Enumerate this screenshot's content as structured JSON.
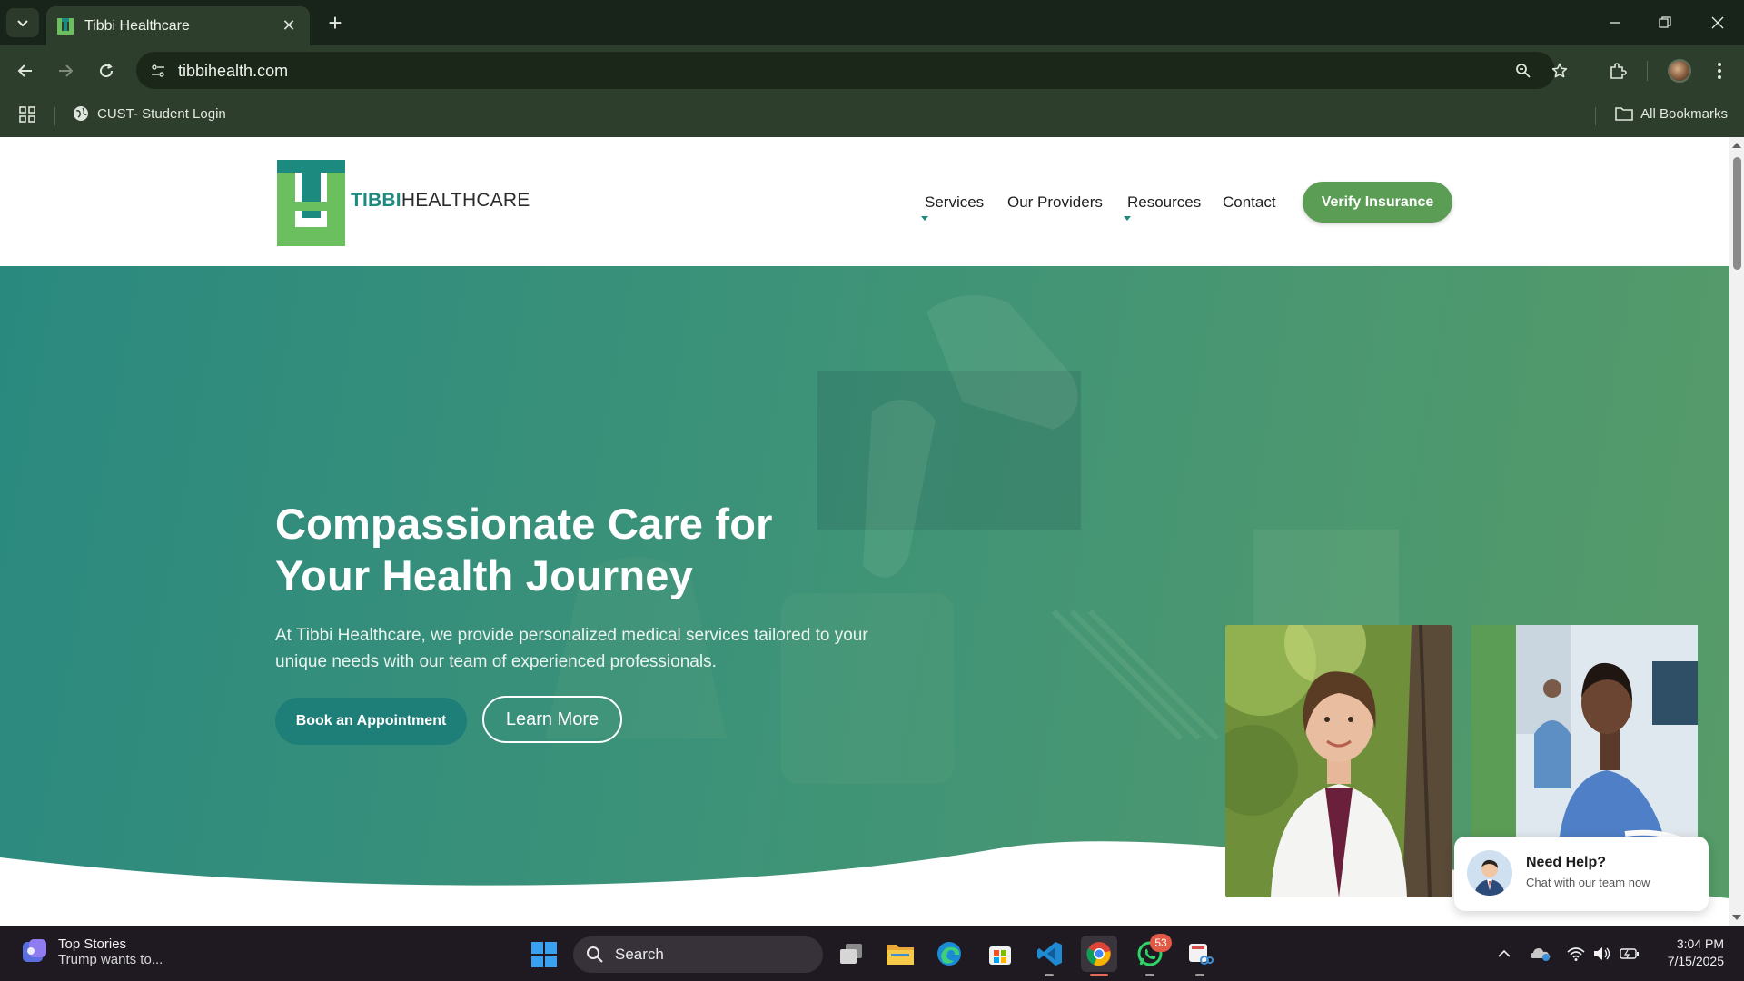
{
  "browser": {
    "tab_title": "Tibbi Healthcare",
    "url": "tibbihealth.com",
    "bookmarks": [
      {
        "label": "CUST- Student Login"
      }
    ],
    "all_bookmarks_label": "All Bookmarks"
  },
  "site": {
    "logo_bold": "TIBBI",
    "logo_regular": "HEALTHCARE",
    "nav": {
      "services": "Services",
      "providers": "Our Providers",
      "resources": "Resources",
      "contact": "Contact"
    },
    "verify_button": "Verify Insurance",
    "hero": {
      "title_line1": "Compassionate Care for",
      "title_line2": "Your Health Journey",
      "subtitle": "At Tibbi Healthcare, we provide personalized medical services tailored to your unique needs with our team of experienced professionals.",
      "primary_button": "Book an Appointment",
      "secondary_button": "Learn More"
    },
    "help_widget": {
      "title": "Need Help?",
      "subtitle": "Chat with our team now"
    },
    "colors": {
      "brand_teal": "#1d8a7f",
      "brand_green": "#5b9d55"
    }
  },
  "taskbar": {
    "news_title": "Top Stories",
    "news_sub": "Trump wants to...",
    "search_label": "Search",
    "whatsapp_badge": "53",
    "time": "3:04 PM",
    "date": "7/15/2025"
  }
}
